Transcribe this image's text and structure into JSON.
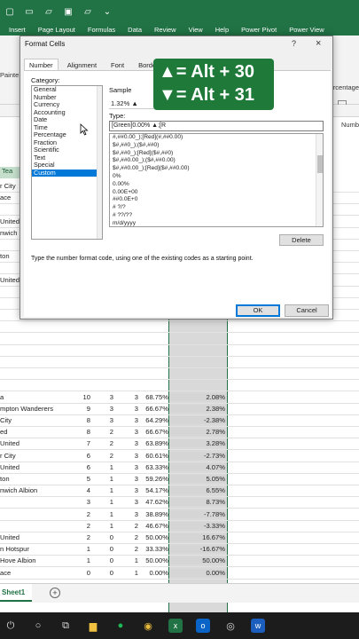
{
  "titlebar": {
    "icons": [
      "document-icon",
      "new-icon",
      "folder-icon",
      "save-icon",
      "folder-icon",
      "more-icon"
    ]
  },
  "ribbon_tabs": [
    "Insert",
    "Page Layout",
    "Formulas",
    "Data",
    "Review",
    "View",
    "Help",
    "Power Pivot",
    "Power View"
  ],
  "ribbon": {
    "painter_label": "Painte",
    "percentage_label": "rcentage",
    "number_label": "Numb"
  },
  "spreadsheet": {
    "teal_label": "Tea",
    "rows": [
      {
        "a": "r City",
        "b": "",
        "c": "",
        "d": "",
        "e": "",
        "f": ""
      },
      {
        "a": "ace",
        "b": "",
        "c": "",
        "d": "",
        "e": "",
        "f": ""
      },
      {
        "a": "",
        "b": "",
        "c": "",
        "d": "",
        "e": "",
        "f": ""
      },
      {
        "a": "United",
        "b": "",
        "c": "",
        "d": "",
        "e": "",
        "f": ""
      },
      {
        "a": "nwich",
        "b": "",
        "c": "",
        "d": "",
        "e": "",
        "f": ""
      },
      {
        "a": "",
        "b": "",
        "c": "",
        "d": "",
        "e": "",
        "f": ""
      },
      {
        "a": "ton",
        "b": "",
        "c": "",
        "d": "",
        "e": "",
        "f": ""
      },
      {
        "a": "",
        "b": "",
        "c": "",
        "d": "",
        "e": "",
        "f": ""
      },
      {
        "a": "United",
        "b": "",
        "c": "",
        "d": "",
        "e": "",
        "f": ""
      },
      {
        "a": "",
        "b": "",
        "c": "",
        "d": "",
        "e": "",
        "f": ""
      },
      {
        "a": "",
        "b": "",
        "c": "",
        "d": "",
        "e": "",
        "f": ""
      },
      {
        "a": "",
        "b": "",
        "c": "",
        "d": "",
        "e": "",
        "f": ""
      },
      {
        "a": "",
        "b": "",
        "c": "",
        "d": "",
        "e": "",
        "f": ""
      },
      {
        "a": "",
        "b": "",
        "c": "",
        "d": "",
        "e": "",
        "f": ""
      },
      {
        "a": "",
        "b": "",
        "c": "",
        "d": "",
        "e": "",
        "f": ""
      },
      {
        "a": "",
        "b": "",
        "c": "",
        "d": "",
        "e": "",
        "f": ""
      },
      {
        "a": "",
        "b": "",
        "c": "",
        "d": "",
        "e": "",
        "f": ""
      },
      {
        "a": "",
        "b": "",
        "c": "",
        "d": "",
        "e": "",
        "f": ""
      },
      {
        "a": "a",
        "b": "10",
        "c": "3",
        "d": "3",
        "e": "68.75%",
        "f": "2.08%"
      },
      {
        "a": "mpton Wanderers",
        "b": "9",
        "c": "3",
        "d": "3",
        "e": "66.67%",
        "f": "2.38%"
      },
      {
        "a": "City",
        "b": "8",
        "c": "3",
        "d": "3",
        "e": "64.29%",
        "f": "-2.38%"
      },
      {
        "a": "ed",
        "b": "8",
        "c": "2",
        "d": "3",
        "e": "66.67%",
        "f": "2.78%"
      },
      {
        "a": "United",
        "b": "7",
        "c": "2",
        "d": "3",
        "e": "63.89%",
        "f": "3.28%"
      },
      {
        "a": "r City",
        "b": "6",
        "c": "2",
        "d": "3",
        "e": "60.61%",
        "f": "-2.73%"
      },
      {
        "a": "United",
        "b": "6",
        "c": "1",
        "d": "3",
        "e": "63.33%",
        "f": "4.07%"
      },
      {
        "a": "ton",
        "b": "5",
        "c": "1",
        "d": "3",
        "e": "59.26%",
        "f": "5.05%"
      },
      {
        "a": "nwich Albion",
        "b": "4",
        "c": "1",
        "d": "3",
        "e": "54.17%",
        "f": "6.55%"
      },
      {
        "a": "",
        "b": "3",
        "c": "1",
        "d": "3",
        "e": "47.62%",
        "f": "8.73%"
      },
      {
        "a": "",
        "b": "2",
        "c": "1",
        "d": "3",
        "e": "38.89%",
        "f": "-7.78%"
      },
      {
        "a": "",
        "b": "2",
        "c": "1",
        "d": "2",
        "e": "46.67%",
        "f": "-3.33%"
      },
      {
        "a": "United",
        "b": "2",
        "c": "0",
        "d": "2",
        "e": "50.00%",
        "f": "16.67%"
      },
      {
        "a": "n Hotspur",
        "b": "1",
        "c": "0",
        "d": "2",
        "e": "33.33%",
        "f": "-16.67%"
      },
      {
        "a": "Hove Albion",
        "b": "1",
        "c": "0",
        "d": "1",
        "e": "50.00%",
        "f": "50.00%"
      },
      {
        "a": "ace",
        "b": "0",
        "c": "0",
        "d": "1",
        "e": "0.00%",
        "f": "0.00%"
      }
    ]
  },
  "sheet_tabs": {
    "active": "Sheet1",
    "add_label": "+"
  },
  "dialog": {
    "title": "Format Cells",
    "help": "?",
    "close": "×",
    "tabs": [
      "Number",
      "Alignment",
      "Font",
      "Borde"
    ],
    "category_label": "Category:",
    "categories": [
      "General",
      "Number",
      "Currency",
      "Accounting",
      "Date",
      "Time",
      "Percentage",
      "Fraction",
      "Scientific",
      "Text",
      "Special",
      "Custom"
    ],
    "selected_category": "Custom",
    "sample_label": "Sample",
    "sample_value": "1.32% ▲",
    "type_label": "Type:",
    "type_value": "[Green]0.00% ▲;[R",
    "formats": [
      "#,##0.00_);[Red](#,##0.00)",
      "$#,##0_);($#,##0)",
      "$#,##0_);[Red]($#,##0)",
      "$#,##0.00_);($#,##0.00)",
      "$#,##0.00_);[Red]($#,##0.00)",
      "0%",
      "0.00%",
      "0.00E+00",
      "##0.0E+0",
      "# ?/?",
      "# ??/??",
      "m/d/yyyy"
    ],
    "delete_label": "Delete",
    "description": "Type the number format code, using one of the existing codes as a starting point.",
    "ok_label": "OK",
    "cancel_label": "Cancel"
  },
  "overlay": {
    "line1": "▲= Alt + 30",
    "line2": "▼= Alt + 31",
    "color": "#1f7a3a"
  },
  "taskbar": {
    "icons": [
      "power-icon",
      "search-icon",
      "task-view-icon",
      "file-explorer-icon",
      "spotify-icon",
      "chrome-icon",
      "excel-icon",
      "outlook-icon",
      "obs-icon",
      "word-icon"
    ]
  }
}
